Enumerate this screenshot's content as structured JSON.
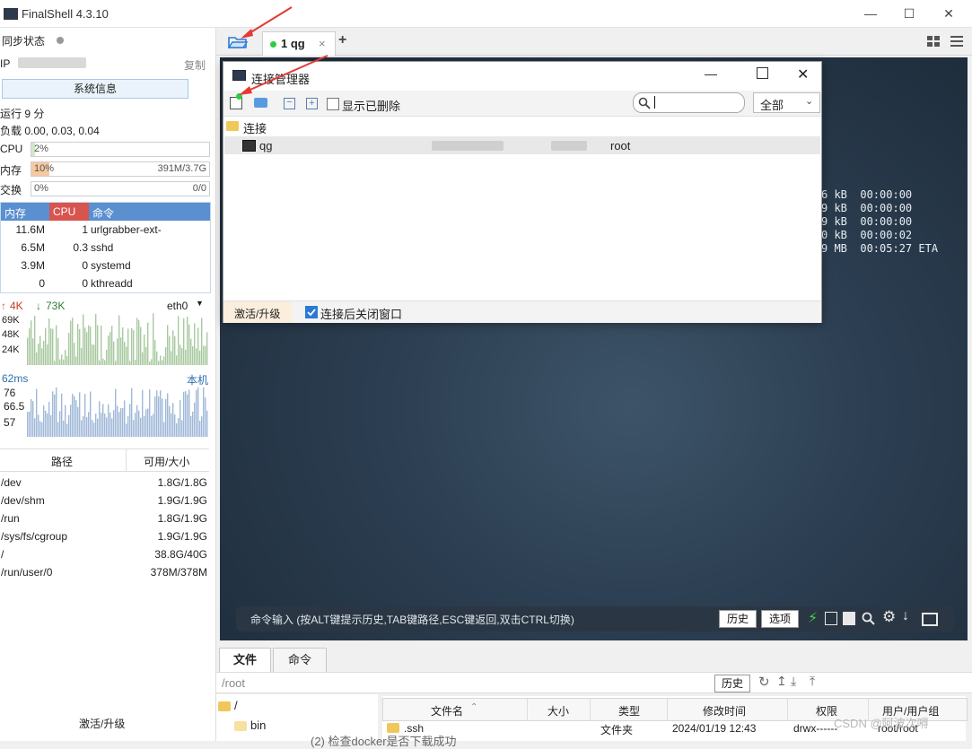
{
  "app": {
    "title": "FinalShell 4.3.10"
  },
  "sidebar": {
    "sync_label": "同步状态",
    "ip_label": "IP",
    "copy_label": "复制",
    "sysinfo_button": "系统信息",
    "uptime": "运行 9 分",
    "load": "负载 0.00, 0.03, 0.04",
    "cpu": {
      "label": "CPU",
      "value": "2%",
      "percent": 2
    },
    "mem": {
      "label": "内存",
      "value": "10%",
      "detail": "391M/3.7G",
      "percent": 10
    },
    "swap": {
      "label": "交换",
      "value": "0%",
      "detail": "0/0",
      "percent": 0
    },
    "proc_headers": [
      "内存",
      "CPU",
      "命令"
    ],
    "processes": [
      {
        "mem": "11.6M",
        "cpu": "1",
        "cmd": "urlgrabber-ext-"
      },
      {
        "mem": "6.5M",
        "cpu": "0.3",
        "cmd": "sshd"
      },
      {
        "mem": "3.9M",
        "cpu": "0",
        "cmd": "systemd"
      },
      {
        "mem": "0",
        "cpu": "0",
        "cmd": "kthreadd"
      }
    ],
    "net": {
      "up": "4K",
      "down": "73K",
      "iface": "eth0",
      "ticks": [
        "69K",
        "48K",
        "24K"
      ]
    },
    "ping": {
      "latency": "62ms",
      "target": "本机",
      "ticks": [
        "76",
        "66.5",
        "57"
      ]
    },
    "fs_headers": [
      "路径",
      "可用/大小"
    ],
    "filesystems": [
      {
        "path": "/dev",
        "size": "1.8G/1.8G"
      },
      {
        "path": "/dev/shm",
        "size": "1.9G/1.9G"
      },
      {
        "path": "/run",
        "size": "1.8G/1.9G"
      },
      {
        "path": "/sys/fs/cgroup",
        "size": "1.9G/1.9G"
      },
      {
        "path": "/",
        "size": "38.8G/40G"
      },
      {
        "path": "/run/user/0",
        "size": "378M/378M"
      }
    ],
    "upgrade_label": "激活/升级"
  },
  "tabs": [
    {
      "label": "1 qg",
      "close": "×"
    }
  ],
  "tab_add": "+",
  "terminal": {
    "lines": [
      "6 kB  00:00:00",
      "9 kB  00:00:00",
      "9 kB  00:00:00",
      "0 kB  00:00:02",
      "9 MB  00:05:27 ETA"
    ],
    "cmd_placeholder": "命令输入 (按ALT键提示历史,TAB键路径,ESC键返回,双击CTRL切换)",
    "history_button": "历史",
    "options_button": "选项"
  },
  "dialog": {
    "title": "连接管理器",
    "show_deleted": "显示已删除",
    "filter_selected": "全部",
    "folder_label": "连接",
    "connections": [
      {
        "name": "qg",
        "user": "root"
      }
    ],
    "footer_upgrade": "激活/升级",
    "close_after_connect": "连接后关闭窗口"
  },
  "bottom": {
    "tabs": [
      "文件",
      "命令"
    ],
    "path": "/root",
    "history_button": "历史",
    "tree": [
      {
        "name": "/"
      },
      {
        "name": "bin"
      }
    ],
    "file_headers": [
      "文件名",
      "大小",
      "类型",
      "修改时间",
      "权限",
      "用户/用户组"
    ],
    "files": [
      {
        "name": ".ssh",
        "size": "",
        "type": "文件夹",
        "mtime": "2024/01/19 12:43",
        "perm": "drwx------",
        "owner": "root/root"
      }
    ],
    "watermark": "CSDN @阿波次嘚",
    "behind_text": "(2) 检查docker是否下载成功"
  },
  "colors": {
    "accent": "#2a7ad5",
    "proc_header": "#5a8fd0",
    "cpu_header": "#d9534f",
    "arrow": "#e53935",
    "terminal_bg": "#2b3d50"
  }
}
